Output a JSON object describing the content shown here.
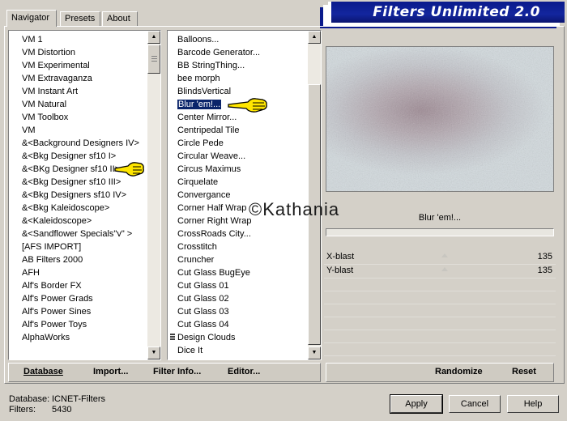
{
  "window": {
    "title": "Filters Unlimited 2.0"
  },
  "tabs": [
    {
      "label": "Navigator",
      "active": true
    },
    {
      "label": "Presets",
      "active": false
    },
    {
      "label": "About",
      "active": false
    }
  ],
  "categories": {
    "items": [
      "VM 1",
      "VM Distortion",
      "VM Experimental",
      "VM Extravaganza",
      "VM Instant Art",
      "VM Natural",
      "VM Toolbox",
      "VM",
      "&<Background Designers IV>",
      "&<Bkg Designer sf10 I>",
      "&<BKg Designer sf10 II>",
      "&<Bkg Designer sf10 III>",
      "&<Bkg Designers sf10 IV>",
      "&<Bkg Kaleidoscope>",
      "&<Kaleidoscope>",
      "&<Sandflower Specials\"v\" >",
      "[AFS IMPORT]",
      "AB Filters 2000",
      "AFH",
      "Alf's Border FX",
      "Alf's Power Grads",
      "Alf's Power Sines",
      "Alf's Power Toys",
      "AlphaWorks"
    ]
  },
  "filters": {
    "items": [
      "Balloons...",
      "Barcode Generator...",
      "BB StringThing...",
      "bee morph",
      "BlindsVertical",
      "Blur 'em!...",
      "Center Mirror...",
      "Centripedal Tile",
      "Circle Pede",
      "Circular Weave...",
      "Circus Maximus",
      "Cirquelate",
      "Convergance",
      "Corner Half Wrap",
      "Corner Right Wrap",
      "CrossRoads City...",
      "Crosstitch",
      "Cruncher",
      "Cut Glass  BugEye",
      "Cut Glass 01",
      "Cut Glass 02",
      "Cut Glass 03",
      "Cut Glass 04",
      "Design Clouds",
      "Dice It"
    ],
    "selected": "Blur 'em!..."
  },
  "preview": {
    "filter_name": "Blur 'em!..."
  },
  "params": [
    {
      "name": "X-blast",
      "value": "135"
    },
    {
      "name": "Y-blast",
      "value": "135"
    }
  ],
  "toolbar_left": {
    "database": "Database",
    "import": "Import...",
    "filter_info": "Filter Info...",
    "editor": "Editor..."
  },
  "toolbar_right": {
    "randomize": "Randomize",
    "reset": "Reset"
  },
  "status": {
    "database_label": "Database:",
    "database_value": "ICNET-Filters",
    "filters_label": "Filters:",
    "filters_value": "5430"
  },
  "buttons": {
    "apply": "Apply",
    "cancel": "Cancel",
    "help": "Help"
  },
  "watermark": "©Kathania",
  "colors": {
    "banner": "#0a1a8c",
    "selection": "#0a246a",
    "background": "#d4d0c8"
  }
}
